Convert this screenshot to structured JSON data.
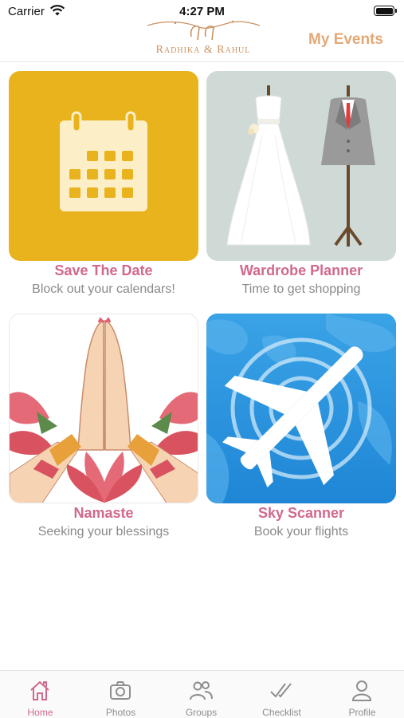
{
  "status_bar": {
    "carrier": "Carrier",
    "time": "4:27 PM"
  },
  "header": {
    "logo_text": "Radhika & Rahul",
    "logo_monogram": "rr",
    "right_link": "My Events",
    "accent_color": "#e3a876"
  },
  "cards": [
    {
      "title": "Save The Date",
      "subtitle": "Block out your calendars!",
      "icon": "calendar-icon",
      "bg": "#e9b31e"
    },
    {
      "title": "Wardrobe Planner",
      "subtitle": "Time to get shopping",
      "icon": "wedding-dress-and-suit-image",
      "bg": "#cfdad7"
    },
    {
      "title": "Namaste",
      "subtitle": "Seeking your blessings",
      "icon": "namaste-hands-image",
      "bg": "#ffffff"
    },
    {
      "title": "Sky Scanner",
      "subtitle": "Book your flights",
      "icon": "airplane-icon",
      "bg": "#2a93dc"
    }
  ],
  "tab_bar": {
    "active_color": "#d1688e",
    "tabs": [
      {
        "label": "Home",
        "icon": "home-icon",
        "active": true
      },
      {
        "label": "Photos",
        "icon": "camera-icon",
        "active": false
      },
      {
        "label": "Groups",
        "icon": "groups-icon",
        "active": false
      },
      {
        "label": "Checklist",
        "icon": "checklist-icon",
        "active": false
      },
      {
        "label": "Profile",
        "icon": "profile-icon",
        "active": false
      }
    ]
  }
}
